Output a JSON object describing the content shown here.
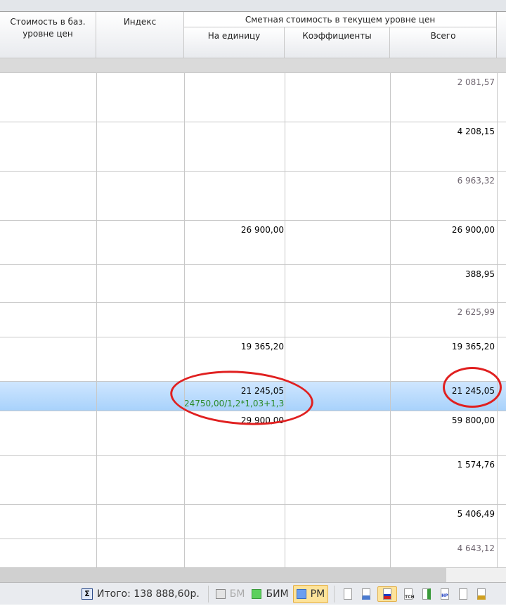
{
  "header": {
    "col_base": "Стоимость в баз. уровне цен",
    "col_index": "Индекс",
    "group_current": "Сметная стоимость в текущем уровне цен",
    "col_unit": "На единицу",
    "col_coef": "Коэффициенты",
    "col_total": "Всего"
  },
  "rows": [
    {
      "unit": "",
      "total": "2 081,57",
      "gray": true
    },
    {
      "unit": "",
      "total": "4 208,15"
    },
    {
      "unit": "",
      "total": "6 963,32",
      "gray": true
    },
    {
      "unit": "26 900,00",
      "total": "26 900,00"
    },
    {
      "unit": "",
      "total": "388,95"
    },
    {
      "unit": "",
      "total": "2 625,99",
      "gray": true
    },
    {
      "unit": "19 365,20",
      "total": "19 365,20"
    },
    {
      "unit": "21 245,05",
      "formula": "24750,00/1,2*1,03+1,3",
      "total": "21 245,05",
      "selected": true
    },
    {
      "unit": "29 900,00",
      "total": "59 800,00"
    },
    {
      "unit": "",
      "total": "1 574,76"
    },
    {
      "unit": "",
      "total": "5 406,49"
    },
    {
      "unit": "",
      "total": "4 643,12",
      "gray": true
    }
  ],
  "status": {
    "total_label": "Итого: 138 888,60р.",
    "bm": "БМ",
    "bim": "БИМ",
    "rm": "РМ"
  },
  "colors": {
    "selection": "#b8dcfd",
    "annotation": "#e02020",
    "formula": "#2a8a2a"
  }
}
